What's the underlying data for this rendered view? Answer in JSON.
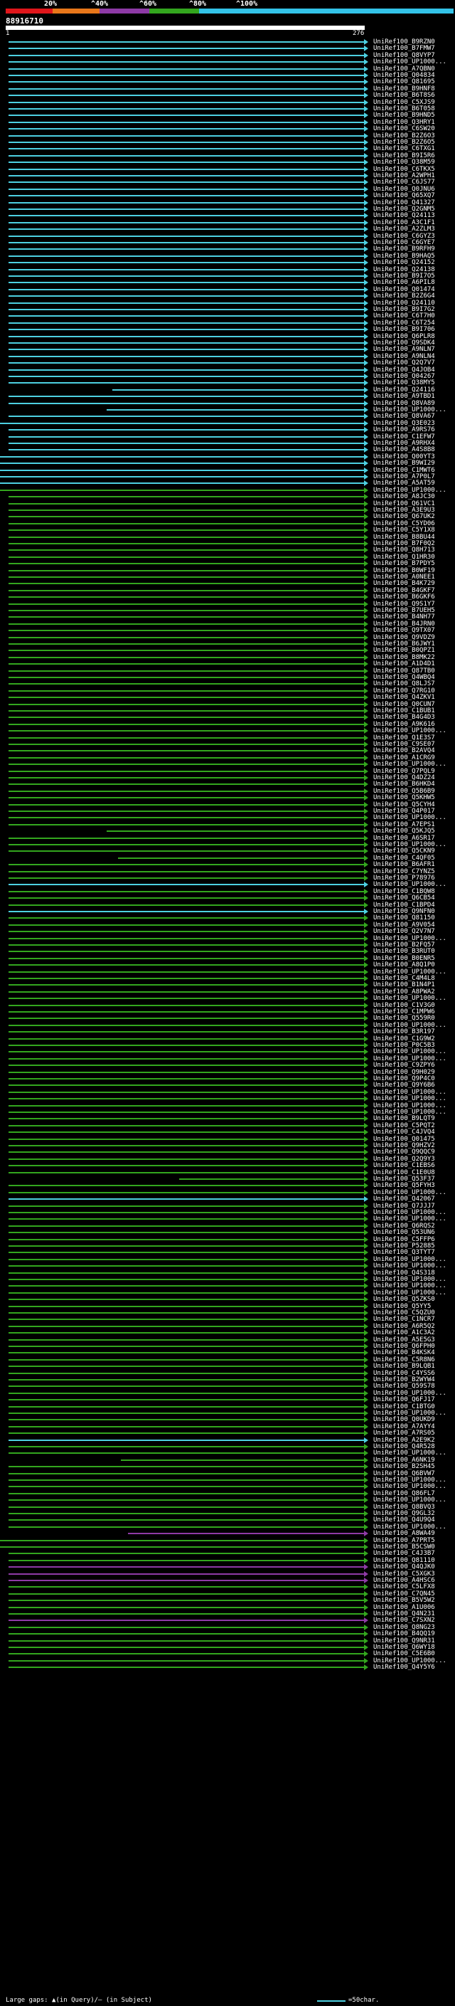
{
  "header": {
    "percent_labels": [
      "20%",
      "^40%",
      "^60%",
      "^80%",
      "^100%"
    ],
    "colors": [
      "#e0161b",
      "#e8771a",
      "#8e3aa6",
      "#33a61e",
      "#33c3e8"
    ],
    "query_name": "88916710",
    "query_start": "1",
    "query_end": "276"
  },
  "footer": {
    "large_gaps": "Large gaps: ▲(in Query)/– (in Subject)",
    "scale": "=50char."
  },
  "hits": [
    {
      "label": "UniRef100_B9RZN0",
      "color": "#4dd0e1"
    },
    {
      "label": "UniRef100_B7FMW7",
      "color": "#4dd0e1"
    },
    {
      "label": "UniRef100_Q8VYP7",
      "color": "#4dd0e1"
    },
    {
      "label": "UniRef100_UP1000...",
      "color": "#4dd0e1"
    },
    {
      "label": "UniRef100_A7QBN0",
      "color": "#4dd0e1"
    },
    {
      "label": "UniRef100_Q04834",
      "color": "#4dd0e1"
    },
    {
      "label": "UniRef100_Q81695",
      "color": "#4dd0e1"
    },
    {
      "label": "UniRef100_B9HNF8",
      "color": "#4dd0e1"
    },
    {
      "label": "UniRef100_B6T8S6",
      "color": "#4dd0e1"
    },
    {
      "label": "UniRef100_C5XJS9",
      "color": "#4dd0e1"
    },
    {
      "label": "UniRef100_B6T058",
      "color": "#4dd0e1"
    },
    {
      "label": "UniRef100_B9HND5",
      "color": "#4dd0e1"
    },
    {
      "label": "UniRef100_Q3HRY1",
      "color": "#4dd0e1"
    },
    {
      "label": "UniRef100_C6SW20",
      "color": "#4dd0e1"
    },
    {
      "label": "UniRef100_B2Z6O3",
      "color": "#4dd0e1"
    },
    {
      "label": "UniRef100_B2Z6O5",
      "color": "#4dd0e1"
    },
    {
      "label": "UniRef100_C6TXG1",
      "color": "#4dd0e1"
    },
    {
      "label": "UniRef100_B9I5R6",
      "color": "#4dd0e1"
    },
    {
      "label": "UniRef100_Q38M59",
      "color": "#4dd0e1"
    },
    {
      "label": "UniRef100_C6TKX5",
      "color": "#4dd0e1"
    },
    {
      "label": "UniRef100_A2WPH1",
      "color": "#4dd0e1"
    },
    {
      "label": "UniRef100_C6JS77",
      "color": "#4dd0e1"
    },
    {
      "label": "UniRef100_Q0JNU6",
      "color": "#4dd0e1"
    },
    {
      "label": "UniRef100_Q65XQ7",
      "color": "#4dd0e1"
    },
    {
      "label": "UniRef100_Q41327",
      "color": "#4dd0e1"
    },
    {
      "label": "UniRef100_Q2GNM5",
      "color": "#4dd0e1"
    },
    {
      "label": "UniRef100_Q24113",
      "color": "#4dd0e1"
    },
    {
      "label": "UniRef100_A3C1F1",
      "color": "#4dd0e1"
    },
    {
      "label": "UniRef100_A2ZLM3",
      "color": "#4dd0e1"
    },
    {
      "label": "UniRef100_C6GYZ3",
      "color": "#4dd0e1"
    },
    {
      "label": "UniRef100_C6GYE7",
      "color": "#4dd0e1"
    },
    {
      "label": "UniRef100_B9RFH9",
      "color": "#4dd0e1"
    },
    {
      "label": "UniRef100_B9HAQ5",
      "color": "#4dd0e1"
    },
    {
      "label": "UniRef100_Q24152",
      "color": "#4dd0e1"
    },
    {
      "label": "UniRef100_Q24138",
      "color": "#4dd0e1"
    },
    {
      "label": "UniRef100_B9I7O5",
      "color": "#4dd0e1"
    },
    {
      "label": "UniRef100_A6PIL8",
      "color": "#4dd0e1"
    },
    {
      "label": "UniRef100_Q01474",
      "color": "#4dd0e1"
    },
    {
      "label": "UniRef100_B2Z6G4",
      "color": "#4dd0e1"
    },
    {
      "label": "UniRef100_Q24110",
      "color": "#4dd0e1"
    },
    {
      "label": "UniRef100_B9I7G2",
      "color": "#4dd0e1"
    },
    {
      "label": "UniRef100_C6T7H0",
      "color": "#4dd0e1"
    },
    {
      "label": "UniRef100_C6T254",
      "color": "#4dd0e1"
    },
    {
      "label": "UniRef100_B9I706",
      "color": "#4dd0e1"
    },
    {
      "label": "UniRef100_Q6PLR8",
      "color": "#4dd0e1"
    },
    {
      "label": "UniRef100_Q9SDK4",
      "color": "#4dd0e1"
    },
    {
      "label": "UniRef100_A9NLN7",
      "color": "#4dd0e1"
    },
    {
      "label": "UniRef100_A9NLN4",
      "color": "#4dd0e1"
    },
    {
      "label": "UniRef100_Q2Q7V7",
      "color": "#4dd0e1"
    },
    {
      "label": "UniRef100_Q4JOB4",
      "color": "#4dd0e1"
    },
    {
      "label": "UniRef100_Q04267",
      "color": "#4dd0e1"
    },
    {
      "label": "UniRef100_Q38MY5",
      "color": "#4dd0e1"
    },
    {
      "label": "UniRef100_Q24116",
      "color": "#4dd0e1"
    },
    {
      "label": "UniRef100_A9TBD1",
      "color": "#4dd0e1"
    },
    {
      "label": "UniRef100_Q8VA89",
      "color": "#4dd0e1"
    },
    {
      "label": "UniRef100_UP1000...",
      "color": "#4dd0e1"
    },
    {
      "label": "UniRef100_Q8VA67",
      "color": "#4dd0e1"
    },
    {
      "label": "UniRef100_Q3E023",
      "color": "#4dd0e1"
    },
    {
      "label": "UniRef100_A9RS76",
      "color": "#4dd0e1"
    },
    {
      "label": "UniRef100_C1EFW7",
      "color": "#4dd0e1"
    },
    {
      "label": "UniRef100_A9RHX4",
      "color": "#4dd0e1"
    },
    {
      "label": "UniRef100_A4S8B8",
      "color": "#4dd0e1"
    },
    {
      "label": "UniRef100_Q00YT3",
      "color": "#4dd0e1"
    },
    {
      "label": "UniRef100_B9WI29",
      "color": "#4dd0e1"
    },
    {
      "label": "UniRef100_C1MWT6",
      "color": "#4dd0e1"
    },
    {
      "label": "UniRef100_A7P0L7",
      "color": "#4dd0e1"
    },
    {
      "label": "UniRef100_A5AT59",
      "color": "#4dd0e1"
    },
    {
      "label": "UniRef100_UP1000...",
      "color": "#33a61e"
    },
    {
      "label": "UniRef100_A8JC30",
      "color": "#33a61e"
    },
    {
      "label": "UniRef100_Q61VC1",
      "color": "#33a61e"
    },
    {
      "label": "UniRef100_A3E9U3",
      "color": "#33a61e"
    },
    {
      "label": "UniRef100_Q67UK2",
      "color": "#33a61e"
    },
    {
      "label": "UniRef100_C5YD06",
      "color": "#33a61e"
    },
    {
      "label": "UniRef100_C5Y1X8",
      "color": "#33a61e"
    },
    {
      "label": "UniRef100_B8BU44",
      "color": "#33a61e"
    },
    {
      "label": "UniRef100_B7F0Q2",
      "color": "#33a61e"
    },
    {
      "label": "UniRef100_Q8H713",
      "color": "#33a61e"
    },
    {
      "label": "UniRef100_Q1HR30",
      "color": "#33a61e"
    },
    {
      "label": "UniRef100_B7PDY5",
      "color": "#33a61e"
    },
    {
      "label": "UniRef100_B0WF19",
      "color": "#33a61e"
    },
    {
      "label": "UniRef100_A0NEE1",
      "color": "#33a61e"
    },
    {
      "label": "UniRef100_B4K729",
      "color": "#33a61e"
    },
    {
      "label": "UniRef100_B4GKF7",
      "color": "#33a61e"
    },
    {
      "label": "UniRef100_B6GKF6",
      "color": "#33a61e"
    },
    {
      "label": "UniRef100_Q9S1Y7",
      "color": "#33a61e"
    },
    {
      "label": "UniRef100_B7UEH5",
      "color": "#33a61e"
    },
    {
      "label": "UniRef100_B4NH77",
      "color": "#33a61e"
    },
    {
      "label": "UniRef100_B4JRN0",
      "color": "#33a61e"
    },
    {
      "label": "UniRef100_Q9TX07",
      "color": "#33a61e"
    },
    {
      "label": "UniRef100_Q9VDZ9",
      "color": "#33a61e"
    },
    {
      "label": "UniRef100_B6JWY1",
      "color": "#33a61e"
    },
    {
      "label": "UniRef100_B0QPZ1",
      "color": "#33a61e"
    },
    {
      "label": "UniRef100_B8MK22",
      "color": "#33a61e"
    },
    {
      "label": "UniRef100_A1D4D1",
      "color": "#33a61e"
    },
    {
      "label": "UniRef100_Q87TB0",
      "color": "#33a61e"
    },
    {
      "label": "UniRef100_Q4WBQ4",
      "color": "#33a61e"
    },
    {
      "label": "UniRef100_Q8LJS7",
      "color": "#33a61e"
    },
    {
      "label": "UniRef100_Q7RG10",
      "color": "#33a61e"
    },
    {
      "label": "UniRef100_Q4ZKV1",
      "color": "#33a61e"
    },
    {
      "label": "UniRef100_Q0CUN7",
      "color": "#33a61e"
    },
    {
      "label": "UniRef100_C1BUB1",
      "color": "#33a61e"
    },
    {
      "label": "UniRef100_B4G4D3",
      "color": "#33a61e"
    },
    {
      "label": "UniRef100_A9K616",
      "color": "#33a61e"
    },
    {
      "label": "UniRef100_UP1000...",
      "color": "#33a61e"
    },
    {
      "label": "UniRef100_Q1E3S7",
      "color": "#33a61e"
    },
    {
      "label": "UniRef100_C9SE07",
      "color": "#33a61e"
    },
    {
      "label": "UniRef100_B2AVQ4",
      "color": "#33a61e"
    },
    {
      "label": "UniRef100_A1CRG9",
      "color": "#33a61e"
    },
    {
      "label": "UniRef100_UP1000...",
      "color": "#33a61e"
    },
    {
      "label": "UniRef100_Q7PQL9",
      "color": "#33a61e"
    },
    {
      "label": "UniRef100_Q4DZ24",
      "color": "#33a61e"
    },
    {
      "label": "UniRef100_B6HKD4",
      "color": "#33a61e"
    },
    {
      "label": "UniRef100_Q5B6B9",
      "color": "#33a61e"
    },
    {
      "label": "UniRef100_Q5KHW5",
      "color": "#33a61e"
    },
    {
      "label": "UniRef100_Q5CYH4",
      "color": "#33a61e"
    },
    {
      "label": "UniRef100_Q4P017",
      "color": "#33a61e"
    },
    {
      "label": "UniRef100_UP1000...",
      "color": "#33a61e"
    },
    {
      "label": "UniRef100_A7EPS1",
      "color": "#33a61e"
    },
    {
      "label": "UniRef100_Q5KJQ5",
      "color": "#33a61e"
    },
    {
      "label": "UniRef100_A6SR17",
      "color": "#33a61e"
    },
    {
      "label": "UniRef100_UP1000...",
      "color": "#33a61e"
    },
    {
      "label": "UniRef100_Q5CKN9",
      "color": "#33a61e"
    },
    {
      "label": "UniRef100_C4QF05",
      "color": "#33a61e"
    },
    {
      "label": "UniRef100_B6AFR1",
      "color": "#33a61e"
    },
    {
      "label": "UniRef100_C7YNZ5",
      "color": "#33a61e"
    },
    {
      "label": "UniRef100_P78976",
      "color": "#33a61e"
    },
    {
      "label": "UniRef100_UP1000...",
      "color": "#4dd0e1"
    },
    {
      "label": "UniRef100_C1BQW8",
      "color": "#33a61e"
    },
    {
      "label": "UniRef100_Q6CB54",
      "color": "#33a61e"
    },
    {
      "label": "UniRef100_C1BPD4",
      "color": "#33a61e"
    },
    {
      "label": "UniRef100_Q9NFN0",
      "color": "#4dd0e1"
    },
    {
      "label": "UniRef100_Q81150",
      "color": "#33a61e"
    },
    {
      "label": "UniRef100_A9V054",
      "color": "#33a61e"
    },
    {
      "label": "UniRef100_Q2V7N7",
      "color": "#33a61e"
    },
    {
      "label": "UniRef100_UP1000...",
      "color": "#33a61e"
    },
    {
      "label": "UniRef100_B2FQ57",
      "color": "#33a61e"
    },
    {
      "label": "UniRef100_B3RUT0",
      "color": "#33a61e"
    },
    {
      "label": "UniRef100_B0ENR5",
      "color": "#33a61e"
    },
    {
      "label": "UniRef100_A8Q1P0",
      "color": "#33a61e"
    },
    {
      "label": "UniRef100_UP1000...",
      "color": "#33a61e"
    },
    {
      "label": "UniRef100_C4M4L8",
      "color": "#33a61e"
    },
    {
      "label": "UniRef100_B1N4P1",
      "color": "#33a61e"
    },
    {
      "label": "UniRef100_A8PWA2",
      "color": "#33a61e"
    },
    {
      "label": "UniRef100_UP1000...",
      "color": "#33a61e"
    },
    {
      "label": "UniRef100_C1V3G0",
      "color": "#33a61e"
    },
    {
      "label": "UniRef100_C1MPW6",
      "color": "#33a61e"
    },
    {
      "label": "UniRef100_Q559R0",
      "color": "#33a61e"
    },
    {
      "label": "UniRef100_UP1000...",
      "color": "#33a61e"
    },
    {
      "label": "UniRef100_B3R197",
      "color": "#33a61e"
    },
    {
      "label": "UniRef100_C1G9W2",
      "color": "#33a61e"
    },
    {
      "label": "UniRef100_P0C5B3",
      "color": "#33a61e"
    },
    {
      "label": "UniRef100_UP1000...",
      "color": "#33a61e"
    },
    {
      "label": "UniRef100_UP1000...",
      "color": "#33a61e"
    },
    {
      "label": "UniRef100_C9ZPY6",
      "color": "#33a61e"
    },
    {
      "label": "UniRef100_Q9H029",
      "color": "#33a61e"
    },
    {
      "label": "UniRef100_Q9P4C0",
      "color": "#33a61e"
    },
    {
      "label": "UniRef100_Q9Y6B6",
      "color": "#33a61e"
    },
    {
      "label": "UniRef100_UP1000...",
      "color": "#33a61e"
    },
    {
      "label": "UniRef100_UP1000...",
      "color": "#33a61e"
    },
    {
      "label": "UniRef100_UP1000...",
      "color": "#33a61e"
    },
    {
      "label": "UniRef100_UP1000...",
      "color": "#33a61e"
    },
    {
      "label": "UniRef100_B9LQT9",
      "color": "#33a61e"
    },
    {
      "label": "UniRef100_C5PQT2",
      "color": "#33a61e"
    },
    {
      "label": "UniRef100_C4JVQ4",
      "color": "#33a61e"
    },
    {
      "label": "UniRef100_Q01475",
      "color": "#33a61e"
    },
    {
      "label": "UniRef100_Q9HZV2",
      "color": "#33a61e"
    },
    {
      "label": "UniRef100_Q9QQC9",
      "color": "#33a61e"
    },
    {
      "label": "UniRef100_Q2Q9Y3",
      "color": "#33a61e"
    },
    {
      "label": "UniRef100_C1EBS6",
      "color": "#33a61e"
    },
    {
      "label": "UniRef100_C1E0U8",
      "color": "#33a61e"
    },
    {
      "label": "UniRef100_Q53F37",
      "color": "#33a61e"
    },
    {
      "label": "UniRef100_Q5FYH3",
      "color": "#33a61e"
    },
    {
      "label": "UniRef100_UP1000...",
      "color": "#33a61e"
    },
    {
      "label": "UniRef100_Q42067",
      "color": "#4dd0e1"
    },
    {
      "label": "UniRef100_Q7JJJ7",
      "color": "#33a61e"
    },
    {
      "label": "UniRef100_UP1000...",
      "color": "#33a61e"
    },
    {
      "label": "UniRef100_UP1000...",
      "color": "#33a61e"
    },
    {
      "label": "UniRef100_Q6RQS2",
      "color": "#33a61e"
    },
    {
      "label": "UniRef100_Q53UN6",
      "color": "#33a61e"
    },
    {
      "label": "UniRef100_C5FFP6",
      "color": "#33a61e"
    },
    {
      "label": "UniRef100_P52885",
      "color": "#33a61e"
    },
    {
      "label": "UniRef100_Q3TYT7",
      "color": "#33a61e"
    },
    {
      "label": "UniRef100_UP1000...",
      "color": "#33a61e"
    },
    {
      "label": "UniRef100_UP1000...",
      "color": "#33a61e"
    },
    {
      "label": "UniRef100_Q4S318",
      "color": "#33a61e"
    },
    {
      "label": "UniRef100_UP1000...",
      "color": "#33a61e"
    },
    {
      "label": "UniRef100_UP1000...",
      "color": "#33a61e"
    },
    {
      "label": "UniRef100_UP1000...",
      "color": "#33a61e"
    },
    {
      "label": "UniRef100_Q5ZKS0",
      "color": "#33a61e"
    },
    {
      "label": "UniRef100_Q5YY5",
      "color": "#33a61e"
    },
    {
      "label": "UniRef100_C5QZU0",
      "color": "#33a61e"
    },
    {
      "label": "UniRef100_C1NCR7",
      "color": "#33a61e"
    },
    {
      "label": "UniRef100_A6R5Q2",
      "color": "#33a61e"
    },
    {
      "label": "UniRef100_A1C3A2",
      "color": "#33a61e"
    },
    {
      "label": "UniRef100_A5E5G3",
      "color": "#33a61e"
    },
    {
      "label": "UniRef100_Q6FPH0",
      "color": "#33a61e"
    },
    {
      "label": "UniRef100_B4KSK4",
      "color": "#33a61e"
    },
    {
      "label": "UniRef100_C5R8N6",
      "color": "#33a61e"
    },
    {
      "label": "UniRef100_B9LQB1",
      "color": "#33a61e"
    },
    {
      "label": "UniRef100_C4YSS6",
      "color": "#33a61e"
    },
    {
      "label": "UniRef100_B2WYW4",
      "color": "#33a61e"
    },
    {
      "label": "UniRef100_Q59S78",
      "color": "#33a61e"
    },
    {
      "label": "UniRef100_UP1000...",
      "color": "#33a61e"
    },
    {
      "label": "UniRef100_Q6FJ17",
      "color": "#33a61e"
    },
    {
      "label": "UniRef100_C1BTG0",
      "color": "#33a61e"
    },
    {
      "label": "UniRef100_UP1000...",
      "color": "#33a61e"
    },
    {
      "label": "UniRef100_Q0UKD9",
      "color": "#33a61e"
    },
    {
      "label": "UniRef100_A7AYY4",
      "color": "#33a61e"
    },
    {
      "label": "UniRef100_A7RS05",
      "color": "#33a61e"
    },
    {
      "label": "UniRef100_A2E9K2",
      "color": "#4dd0e1"
    },
    {
      "label": "UniRef100_Q4R528",
      "color": "#33a61e"
    },
    {
      "label": "UniRef100_UP1000...",
      "color": "#33a61e"
    },
    {
      "label": "UniRef100_A6NK19",
      "color": "#33a61e"
    },
    {
      "label": "UniRef100_B2SH45",
      "color": "#33a61e"
    },
    {
      "label": "UniRef100_Q6BVW7",
      "color": "#33a61e"
    },
    {
      "label": "UniRef100_UP1000...",
      "color": "#33a61e"
    },
    {
      "label": "UniRef100_UP1000...",
      "color": "#33a61e"
    },
    {
      "label": "UniRef100_Q86FL7",
      "color": "#33a61e"
    },
    {
      "label": "UniRef100_UP1000...",
      "color": "#33a61e"
    },
    {
      "label": "UniRef100_Q8BVQ3",
      "color": "#33a61e"
    },
    {
      "label": "UniRef100_Q9GL32",
      "color": "#33a61e"
    },
    {
      "label": "UniRef100_Q4U9Q4",
      "color": "#33a61e"
    },
    {
      "label": "UniRef100_UP1000...",
      "color": "#33a61e"
    },
    {
      "label": "UniRef100_A8WA49",
      "color": "#8e3aa6"
    },
    {
      "label": "UniRef100_A7PRT5",
      "color": "#33a61e"
    },
    {
      "label": "UniRef100_B5CSW0",
      "color": "#33a61e"
    },
    {
      "label": "UniRef100_C4J3B7",
      "color": "#33a61e"
    },
    {
      "label": "UniRef100_Q81110",
      "color": "#33a61e"
    },
    {
      "label": "UniRef100_Q4QJK0",
      "color": "#8e3aa6"
    },
    {
      "label": "UniRef100_C5XGK3",
      "color": "#8e3aa6"
    },
    {
      "label": "UniRef100_A4HSC6",
      "color": "#8e3aa6"
    },
    {
      "label": "UniRef100_C5LFX8",
      "color": "#33a61e"
    },
    {
      "label": "UniRef100_C7QN45",
      "color": "#33a61e"
    },
    {
      "label": "UniRef100_B5V5W2",
      "color": "#33a61e"
    },
    {
      "label": "UniRef100_A1U006",
      "color": "#33a61e"
    },
    {
      "label": "UniRef100_Q4N231",
      "color": "#33a61e"
    },
    {
      "label": "UniRef100_C7SXN2",
      "color": "#8e3aa6"
    },
    {
      "label": "UniRef100_Q8NG23",
      "color": "#33a61e"
    },
    {
      "label": "UniRef100_B4QQ19",
      "color": "#33a61e"
    },
    {
      "label": "UniRef100_Q9NR31",
      "color": "#33a61e"
    },
    {
      "label": "UniRef100_Q6WY18",
      "color": "#33a61e"
    },
    {
      "label": "UniRef100_C5E6B0",
      "color": "#33a61e"
    },
    {
      "label": "UniRef100_UP1000...",
      "color": "#33a61e"
    },
    {
      "label": "UniRef100_Q4Y5Y6",
      "color": "#33a61e"
    }
  ]
}
